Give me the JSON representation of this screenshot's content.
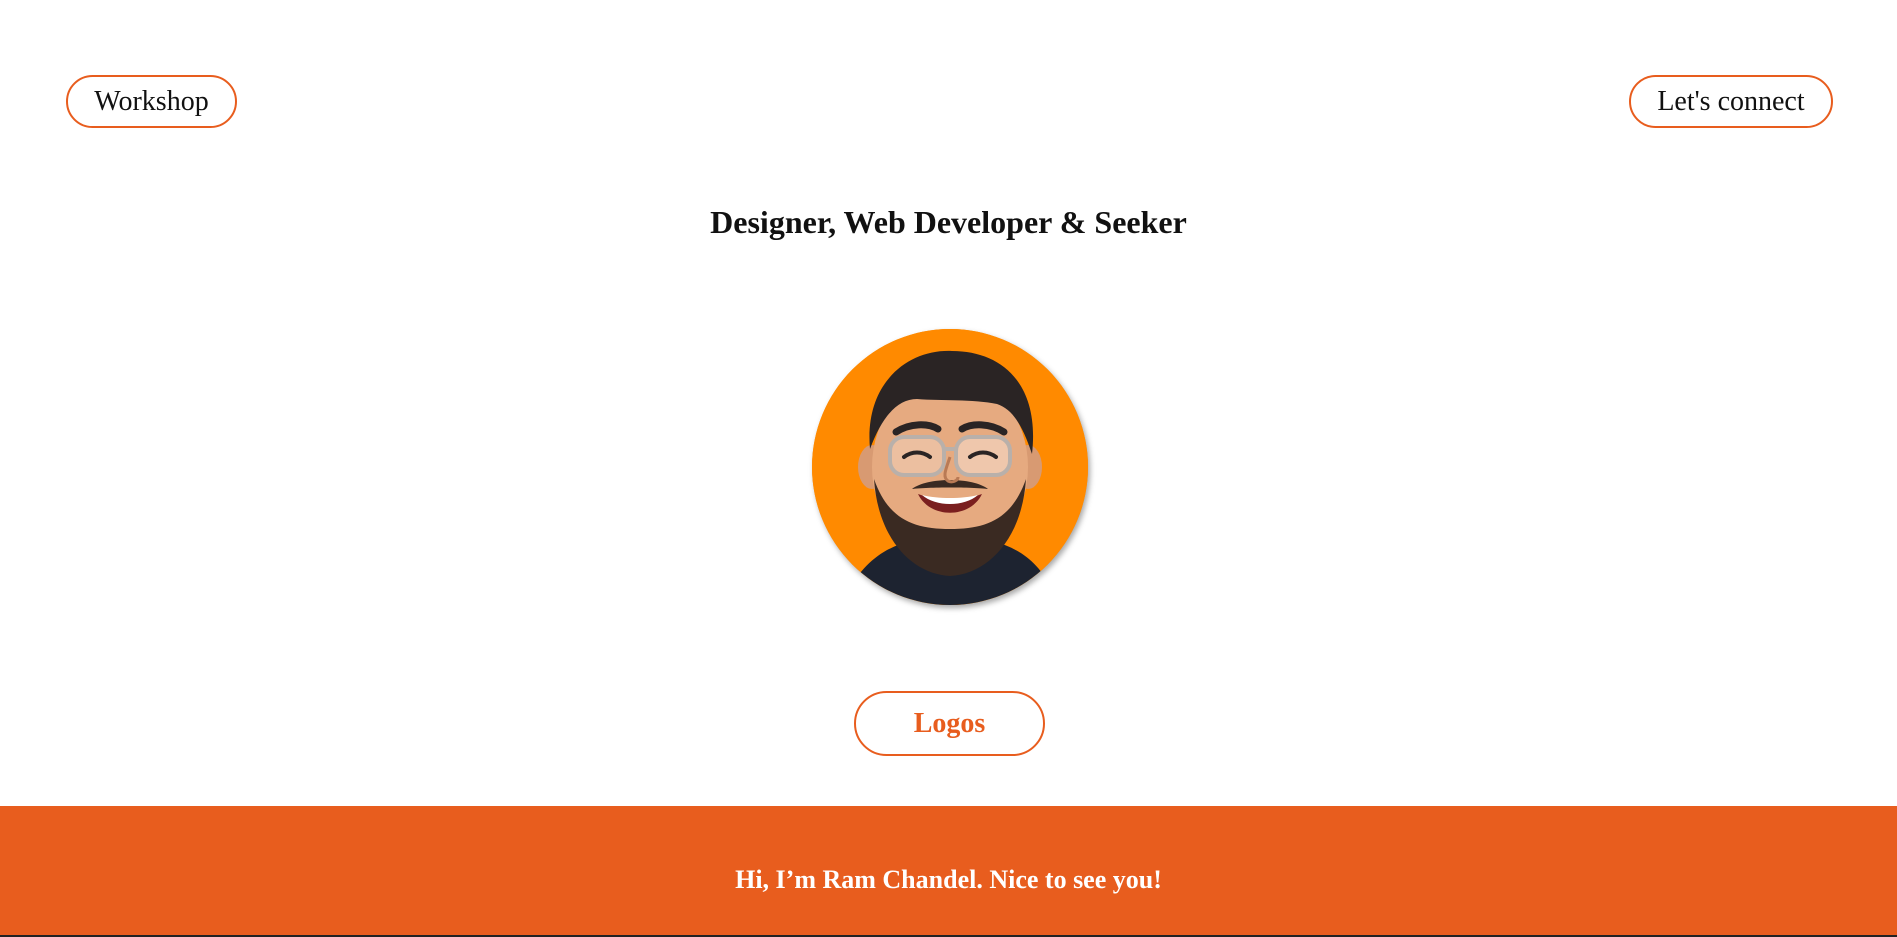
{
  "header": {
    "workshop_label": "Workshop",
    "connect_label": "Let's connect"
  },
  "hero": {
    "tagline": "Designer, Web Developer & Seeker",
    "logos_label": "Logos"
  },
  "footer": {
    "greeting": "Hi, I’m Ram Chandel. Nice to see you!"
  },
  "colors": {
    "accent": "#e85d1e",
    "avatar_background": "#ff8a00",
    "text": "#111111",
    "footer_text": "#ffffff"
  }
}
